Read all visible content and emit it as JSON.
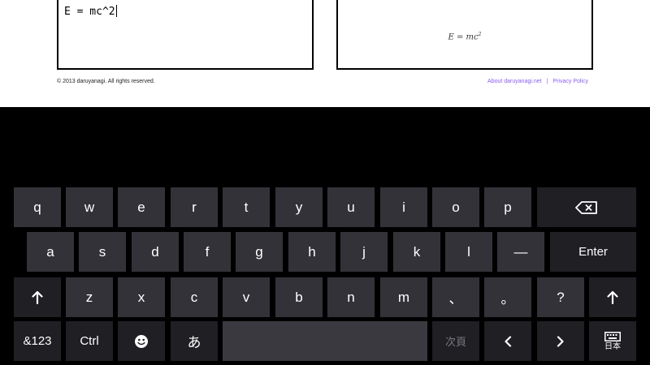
{
  "page": {
    "editor_text": "E = mc^2",
    "preview": {
      "base": "E = mc",
      "exponent": "2"
    },
    "copyright": "© 2013 daruyanagi. All rights reserved.",
    "links": {
      "about": "About daruyanagi.net",
      "separator": "|",
      "privacy": "Privacy Policy"
    }
  },
  "keyboard": {
    "row1": [
      "q",
      "w",
      "e",
      "r",
      "t",
      "y",
      "u",
      "i",
      "o",
      "p"
    ],
    "row2": [
      "a",
      "s",
      "d",
      "f",
      "g",
      "h",
      "j",
      "k",
      "l",
      "—"
    ],
    "row2_enter": "Enter",
    "row3": [
      "z",
      "x",
      "c",
      "v",
      "b",
      "n",
      "m",
      "、",
      "。",
      "?"
    ],
    "row4": {
      "symbols": "&123",
      "ctrl": "Ctrl",
      "kana": "あ",
      "next_page": "次頁",
      "ime_mode": "日本"
    },
    "icons": {
      "backspace": "backspace-icon",
      "shift": "arrow-up-icon",
      "emoji": "smiley-icon",
      "left": "chevron-left-icon",
      "right": "chevron-right-icon",
      "keyboard": "keyboard-icon"
    },
    "colors": {
      "key": "#343239",
      "dark_key": "#1f1f24",
      "background": "#000000",
      "link": "#8a5cf0"
    }
  }
}
